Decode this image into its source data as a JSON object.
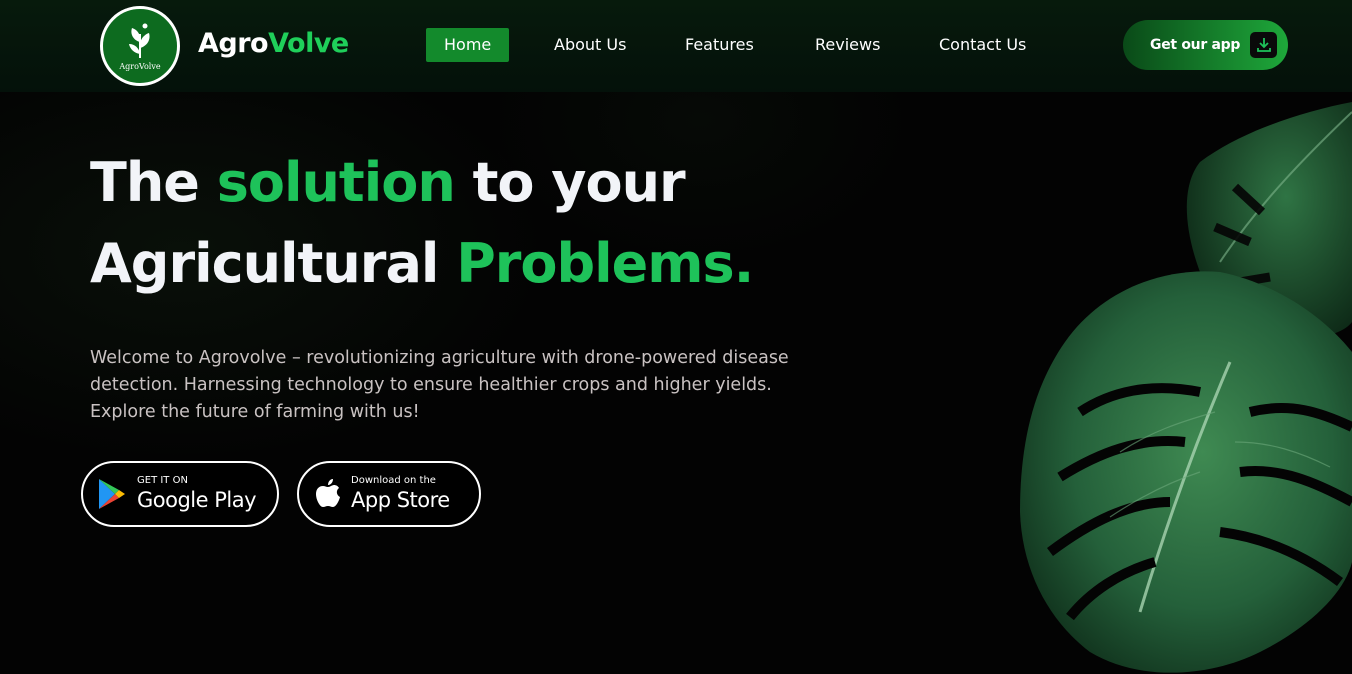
{
  "brand": {
    "logo_small_text": "AgroVolve",
    "name_part1": "Agro",
    "name_part2": "Volve"
  },
  "nav": {
    "items": [
      {
        "label": "Home",
        "active": true
      },
      {
        "label": "About Us",
        "active": false
      },
      {
        "label": "Features",
        "active": false
      },
      {
        "label": "Reviews",
        "active": false
      },
      {
        "label": "Contact Us",
        "active": false
      }
    ],
    "cta_label": "Get our app",
    "cta_icon": "download-icon"
  },
  "hero": {
    "line1_a": "The ",
    "line1_b": "solution",
    "line1_c": " to your",
    "line2_a": "Agricultural ",
    "line2_b": "Problems.",
    "description": "Welcome to Agrovolve – revolutionizing agriculture with drone-powered disease detection. Harnessing technology to ensure healthier crops and higher yields. Explore the future of farming with us!"
  },
  "stores": {
    "google": {
      "small": "GET IT ON",
      "big": "Google Play",
      "icon": "google-play-icon"
    },
    "apple": {
      "small": "Download on the",
      "big": "App Store",
      "icon": "apple-icon"
    }
  },
  "colors": {
    "accent": "#1ec25a",
    "nav_active": "#138a2c",
    "background": "#030303"
  }
}
